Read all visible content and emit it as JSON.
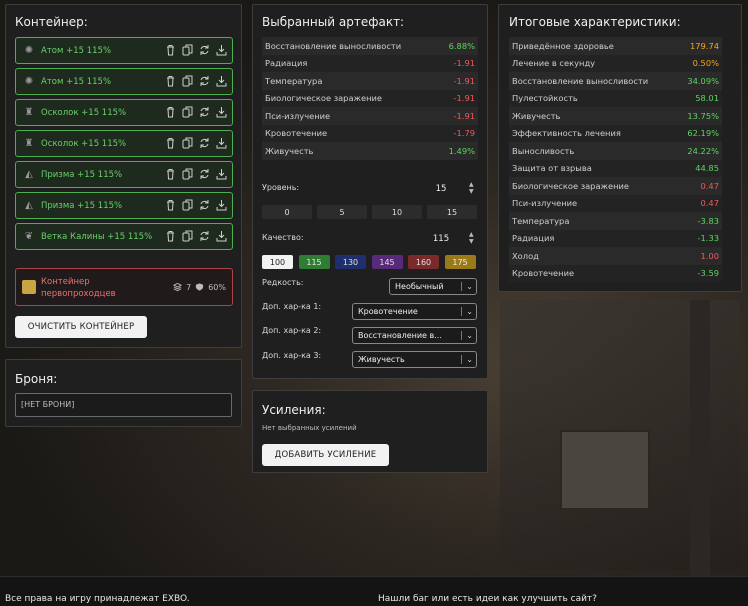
{
  "container": {
    "title": "Контейнер:",
    "items": [
      {
        "label": "Атом +15 115%",
        "icon": "atom-icon"
      },
      {
        "label": "Атом +15 115%",
        "icon": "atom-icon"
      },
      {
        "label": "Осколок +15 115%",
        "icon": "shard-icon"
      },
      {
        "label": "Осколок +15 115%",
        "icon": "shard-icon"
      },
      {
        "label": "Призма +15 115%",
        "icon": "prism-icon"
      },
      {
        "label": "Призма +15 115%",
        "icon": "prism-icon"
      },
      {
        "label": "Ветка Калины +15 115%",
        "icon": "branch-icon"
      }
    ],
    "pioneer": {
      "name": "Контейнер первопроходцев",
      "slots": "7",
      "protection": "60%"
    },
    "clear_button": "ОЧИСТИТЬ КОНТЕЙНЕР"
  },
  "armor": {
    "title": "Броня:",
    "value": "[НЕТ БРОНИ]"
  },
  "artifact": {
    "title": "Выбранный артефакт:",
    "stats": [
      {
        "name": "Восстановление выносливости",
        "value": "6.88%",
        "color": "green"
      },
      {
        "name": "Радиация",
        "value": "-1.91",
        "color": "red"
      },
      {
        "name": "Температура",
        "value": "-1.91",
        "color": "red"
      },
      {
        "name": "Биологическое заражение",
        "value": "-1.91",
        "color": "red"
      },
      {
        "name": "Пси-излучение",
        "value": "-1.91",
        "color": "red"
      },
      {
        "name": "Кровотечение",
        "value": "-1.79",
        "color": "red"
      },
      {
        "name": "Живучесть",
        "value": "1.49%",
        "color": "green"
      }
    ],
    "level_label": "Уровень:",
    "level_value": "15",
    "level_presets": [
      "0",
      "5",
      "10",
      "15"
    ],
    "quality_label": "Качество:",
    "quality_value": "115",
    "quality_presets": [
      {
        "label": "100",
        "bg": "#f2f2f2",
        "fg": "#222"
      },
      {
        "label": "115",
        "bg": "#2e7d32",
        "fg": "#e8e8e8"
      },
      {
        "label": "130",
        "bg": "#1f2f6e",
        "fg": "#e0e0e0"
      },
      {
        "label": "145",
        "bg": "#5a2a7a",
        "fg": "#e0e0e0"
      },
      {
        "label": "160",
        "bg": "#7a2a2a",
        "fg": "#e0e0e0"
      },
      {
        "label": "175",
        "bg": "#9a7a18",
        "fg": "#f0f0f0"
      }
    ],
    "rarity_label": "Редкость:",
    "rarity_value": "Необычный",
    "extra1_label": "Доп. хар-ка 1:",
    "extra1_value": "Кровотечение",
    "extra2_label": "Доп. хар-ка 2:",
    "extra2_value": "Восстановление в...",
    "extra3_label": "Доп. хар-ка 3:",
    "extra3_value": "Живучесть"
  },
  "boosts": {
    "title": "Усиления:",
    "empty_text": "Нет выбранных усилений",
    "add_button": "ДОБАВИТЬ УСИЛЕНИЕ"
  },
  "totals": {
    "title": "Итоговые характеристики:",
    "stats": [
      {
        "name": "Приведённое здоровье",
        "value": "179.74",
        "color": "orange"
      },
      {
        "name": "Лечение в секунду",
        "value": "0.50%",
        "color": "orange"
      },
      {
        "name": "Восстановление выносливости",
        "value": "34.09%",
        "color": "green"
      },
      {
        "name": "Пулестойкость",
        "value": "58.01",
        "color": "green"
      },
      {
        "name": "Живучесть",
        "value": "13.75%",
        "color": "green"
      },
      {
        "name": "Эффективность лечения",
        "value": "62.19%",
        "color": "green"
      },
      {
        "name": "Выносливость",
        "value": "24.22%",
        "color": "green"
      },
      {
        "name": "Защита от взрыва",
        "value": "44.85",
        "color": "green"
      },
      {
        "name": "Биологическое заражение",
        "value": "0.47",
        "color": "red"
      },
      {
        "name": "Пси-излучение",
        "value": "0.47",
        "color": "red"
      },
      {
        "name": "Температура",
        "value": "-3.83",
        "color": "green"
      },
      {
        "name": "Радиация",
        "value": "-1.33",
        "color": "green"
      },
      {
        "name": "Холод",
        "value": "1.00",
        "color": "red"
      },
      {
        "name": "Кровотечение",
        "value": "-3.59",
        "color": "green"
      }
    ]
  },
  "footer": {
    "left": "Все права на игру принадлежат EXBO.",
    "right": "Нашли баг или есть идеи как улучшить сайт?"
  }
}
